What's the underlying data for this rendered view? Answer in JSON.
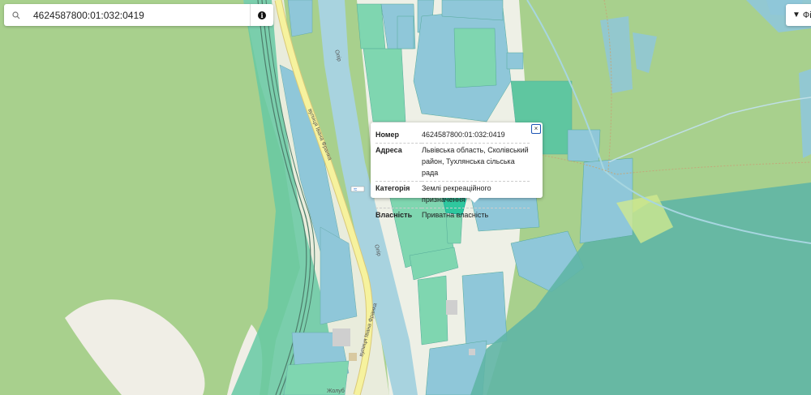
{
  "search": {
    "value": "4624587800:01:032:0419"
  },
  "filter": {
    "label": "Фі"
  },
  "popup": {
    "rows": [
      {
        "key": "Номер",
        "value": "4624587800:01:032:0419"
      },
      {
        "key": "Адреса",
        "value": "Львівська область, Сколівський район, Тухлянська сільська рада"
      },
      {
        "key": "Категорія",
        "value": "Землі рекреаційного призначення"
      },
      {
        "key": "Власність",
        "value": "Приватна власність"
      }
    ],
    "close_label": "×"
  },
  "map_labels": {
    "street_upper": "вулиця Івана Франка",
    "street_lower": "вулиця Івана Франка",
    "river_upper": "Опір",
    "river_lower": "Опір",
    "bottom_label": "Жолуб"
  },
  "colors": {
    "forest": "#a8d08d",
    "parcel_blue": "#8fc7d9",
    "parcel_green": "#7fd6b0",
    "parcel_teal": "#5fb5a5",
    "road_yellow": "#f6f29e",
    "river": "#a8d3df",
    "accent_close": "#1f56b5"
  }
}
